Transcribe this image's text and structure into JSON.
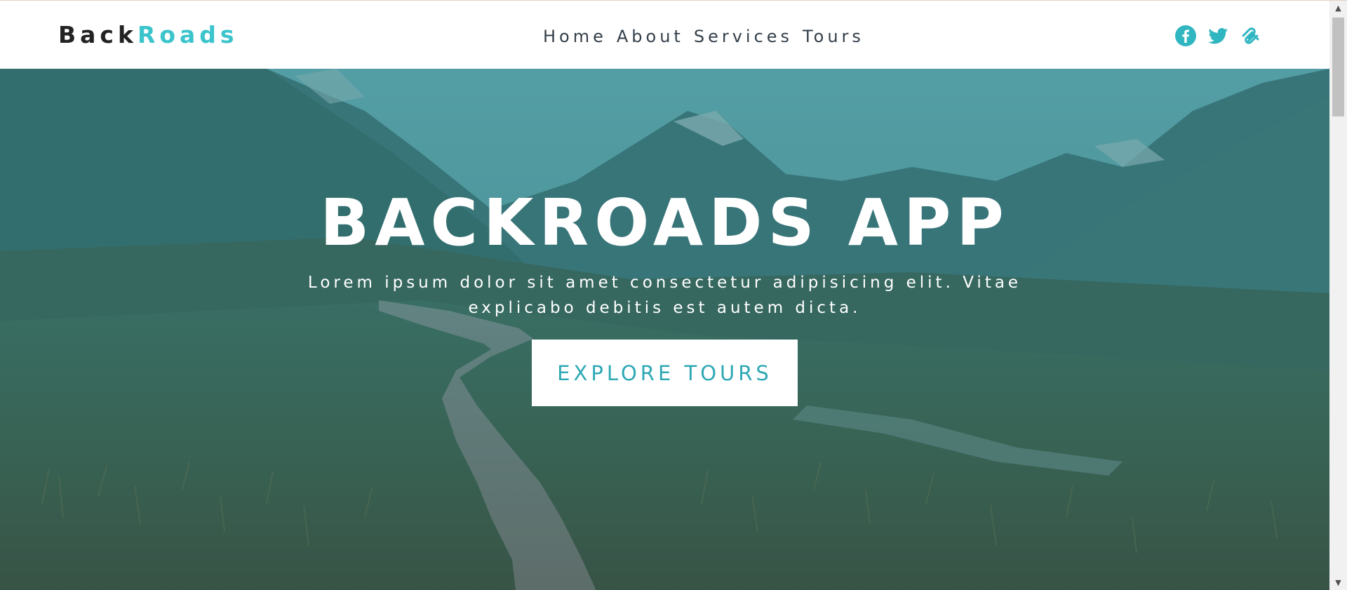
{
  "brand": {
    "logo_part1": "Back",
    "logo_part2": "Roads",
    "accent_color": "#3cc4cc"
  },
  "nav": {
    "links": [
      "Home",
      "About",
      "Services",
      "Tours"
    ]
  },
  "social": {
    "icons": [
      "facebook-icon",
      "twitter-icon",
      "squarespace-icon"
    ]
  },
  "hero": {
    "title": "BACKROADS APP",
    "subtitle": "Lorem ipsum dolor sit amet consectetur adipisicing elit. Vitae explicabo debitis est autem dicta.",
    "button_label": "EXPLORE TOURS",
    "button_text_color": "#2fa8b5",
    "overlay_color": "#2b8e96"
  }
}
